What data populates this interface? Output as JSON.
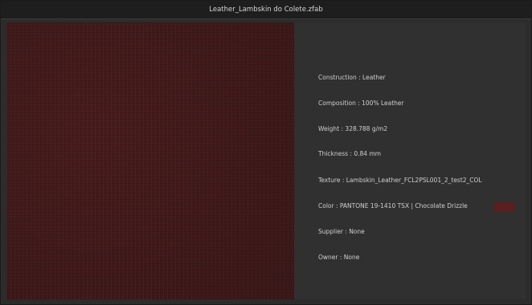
{
  "window": {
    "title": "Leather_Lambskin do Colete.zfab"
  },
  "info": {
    "construction": "Construction : Leather",
    "composition": "Composition : 100% Leather",
    "weight": "Weight : 328.788 g/m2",
    "thickness": "Thickness : 0.84 mm",
    "texture": "Texture : Lambskin_Leather_FCL2PSL001_2_test2_COL",
    "color": "Color : PANTONE 19-1410 TSX | Chocolate Drizzle",
    "supplier": "Supplier : None",
    "owner": "Owner : None"
  },
  "colors": {
    "swatch": "#3d1a1a",
    "color_chip": "#5b1f1f",
    "panel_bg": "#303030",
    "titlebar_bg": "#1e1e1e"
  }
}
